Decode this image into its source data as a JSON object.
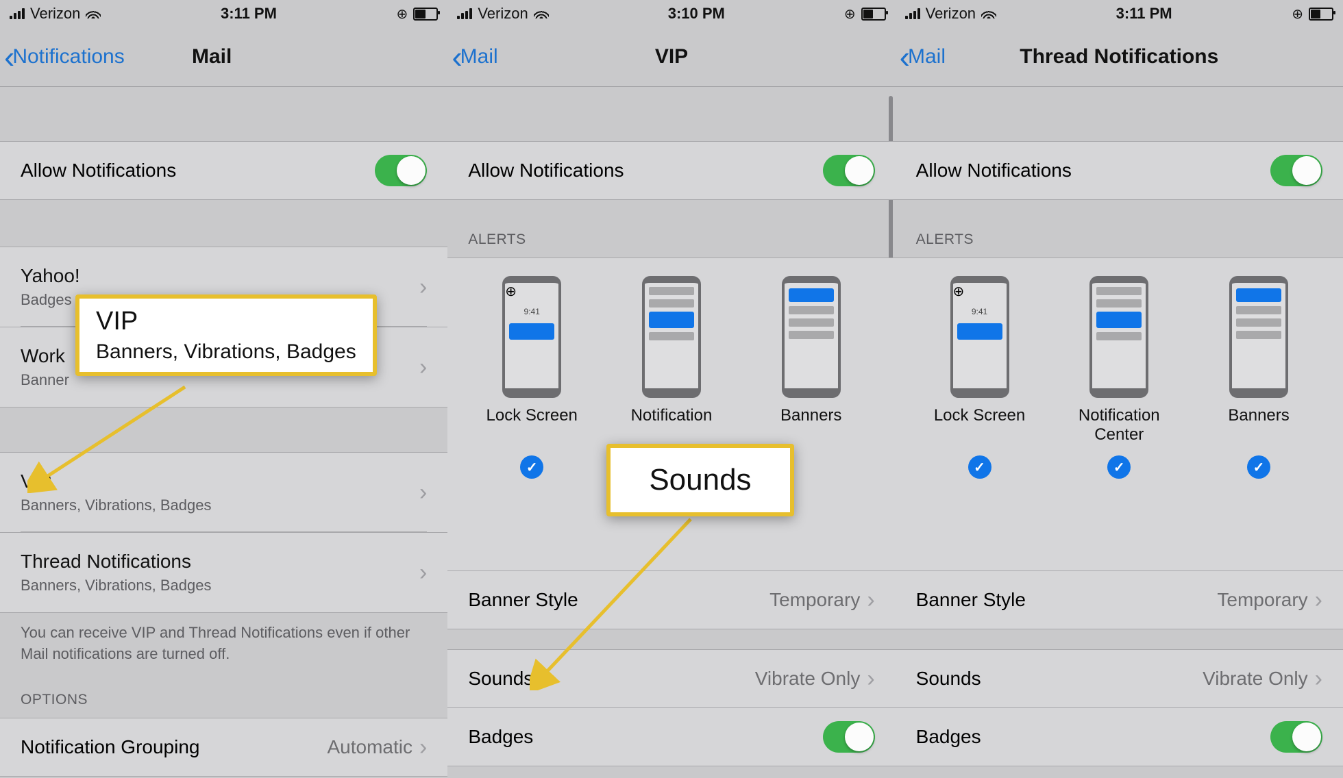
{
  "screen1": {
    "status": {
      "carrier": "Verizon",
      "time": "3:11 PM"
    },
    "nav": {
      "back": "Notifications",
      "title": "Mail"
    },
    "allow": "Allow Notifications",
    "accounts": [
      {
        "t": "Yahoo!",
        "s": "Badges"
      },
      {
        "t": "Work",
        "s": "Banner"
      }
    ],
    "vip": {
      "t": "VIP",
      "s": "Banners, Vibrations, Badges"
    },
    "threads": {
      "t": "Thread Notifications",
      "s": "Banners, Vibrations, Badges"
    },
    "note": "You can receive VIP and Thread Notifications even if other Mail notifications are turned off.",
    "options_header": "OPTIONS",
    "grouping": {
      "t": "Notification Grouping",
      "v": "Automatic"
    },
    "callout": {
      "t": "VIP",
      "s": "Banners, Vibrations, Badges"
    }
  },
  "screen2": {
    "status": {
      "carrier": "Verizon",
      "time": "3:10 PM"
    },
    "nav": {
      "back": "Mail",
      "title": "VIP"
    },
    "allow": "Allow Notifications",
    "alerts_header": "ALERTS",
    "alertopts": [
      {
        "lbl": "Lock Screen",
        "time": "9:41"
      },
      {
        "lbl": "Notification"
      },
      {
        "lbl": "Banners"
      }
    ],
    "banner": {
      "t": "Banner Style",
      "v": "Temporary"
    },
    "sounds": {
      "t": "Sounds",
      "v": "Vibrate Only"
    },
    "badges": {
      "t": "Badges"
    },
    "callout": {
      "t": "Sounds"
    }
  },
  "screen3": {
    "status": {
      "carrier": "Verizon",
      "time": "3:11 PM"
    },
    "nav": {
      "back": "Mail",
      "title": "Thread Notifications"
    },
    "allow": "Allow Notifications",
    "alerts_header": "ALERTS",
    "alertopts": [
      {
        "lbl": "Lock Screen",
        "time": "9:41"
      },
      {
        "lbl": "Notification Center"
      },
      {
        "lbl": "Banners"
      }
    ],
    "banner": {
      "t": "Banner Style",
      "v": "Temporary"
    },
    "sounds": {
      "t": "Sounds",
      "v": "Vibrate Only"
    },
    "badges": {
      "t": "Badges"
    }
  }
}
